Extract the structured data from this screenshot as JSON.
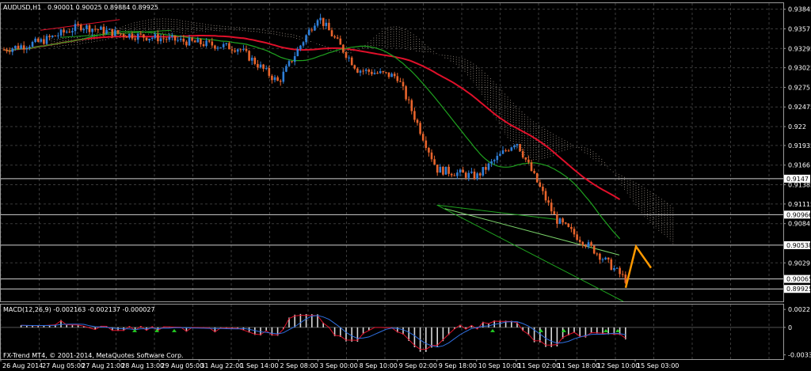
{
  "window": {
    "symbol_title": "AUDUSD,H1",
    "ohlc": "0.90001 0.90025 0.89884 0.89925",
    "copyright": "FX-Trend MT4, © 2001-2014, MetaQuotes Software Corp."
  },
  "colors": {
    "background": "#000000",
    "grid": "#3a3a3a",
    "candle_up": "#2f7fd8",
    "candle_down": "#e8642c",
    "ma_red": "#e0102a",
    "ma_green": "#1fa21f",
    "cloud": "#d8c8b8",
    "hline": "#d0d0d0",
    "projection": "#ff9900",
    "macd_hist": "#d8d8d8",
    "macd_signal_blue": "#2f6fe0",
    "macd_line_red": "#e0102a",
    "arrow_green": "#22cc22"
  },
  "chart_data": [
    {
      "type": "candlestick",
      "instrument": "AUDUSD",
      "timeframe": "H1",
      "x_ticks": [
        "26 Aug 2014",
        "27 Aug 05:00",
        "27 Aug 21:00",
        "28 Aug 13:00",
        "29 Aug 05:00",
        "31 Aug 22:00",
        "1 Sep 14:00",
        "2 Sep 08:00",
        "3 Sep 00:00",
        "8 Sep 10:00",
        "9 Sep 02:00",
        "9 Sep 18:00",
        "10 Sep 10:00",
        "11 Sep 02:00",
        "11 Sep 18:00",
        "12 Sep 10:00",
        "15 Sep 03:00"
      ],
      "y_ticks": [
        0.93845,
        0.9357,
        0.93295,
        0.93025,
        0.9275,
        0.92475,
        0.922,
        0.91935,
        0.9166,
        0.91385,
        0.91115,
        0.9084,
        0.9029
      ],
      "y_range": [
        0.8975,
        0.9393
      ],
      "horizontal_levels": [
        0.9147,
        0.90966,
        0.90538,
        0.90065,
        0.89925
      ],
      "path_keypoints": [
        {
          "x": "26 Aug 2014",
          "y": 0.9327
        },
        {
          "x": "27 Aug 05:00",
          "y": 0.9339
        },
        {
          "x": "27 Aug 21:00",
          "y": 0.9361
        },
        {
          "x": "28 Aug 13:00",
          "y": 0.935
        },
        {
          "x": "29 Aug 05:00",
          "y": 0.9344
        },
        {
          "x": "31 Aug 22:00",
          "y": 0.9337
        },
        {
          "x": "1 Sep 14:00",
          "y": 0.933
        },
        {
          "x": "2 Sep 08:00",
          "y": 0.9282
        },
        {
          "x": "3 Sep 00:00",
          "y": 0.9375
        },
        {
          "x": "8 Sep 10:00",
          "y": 0.93
        },
        {
          "x": "9 Sep 02:00",
          "y": 0.929
        },
        {
          "x": "9 Sep 18:00",
          "y": 0.916
        },
        {
          "x": "10 Sep 10:00",
          "y": 0.915
        },
        {
          "x": "11 Sep 02:00",
          "y": 0.92
        },
        {
          "x": "11 Sep 18:00",
          "y": 0.909
        },
        {
          "x": "12 Sep 10:00",
          "y": 0.9045
        },
        {
          "x": "15 Sep 03:00",
          "y": 0.8993
        }
      ]
    },
    {
      "type": "line",
      "indicator": "MACD",
      "params": "MACD(12,26,9) -0.002163 -0.002137 -0.000027",
      "y_ticks": [
        0.0022,
        0.0,
        -0.003377
      ],
      "y_range": [
        -0.0039,
        0.0028
      ]
    }
  ]
}
